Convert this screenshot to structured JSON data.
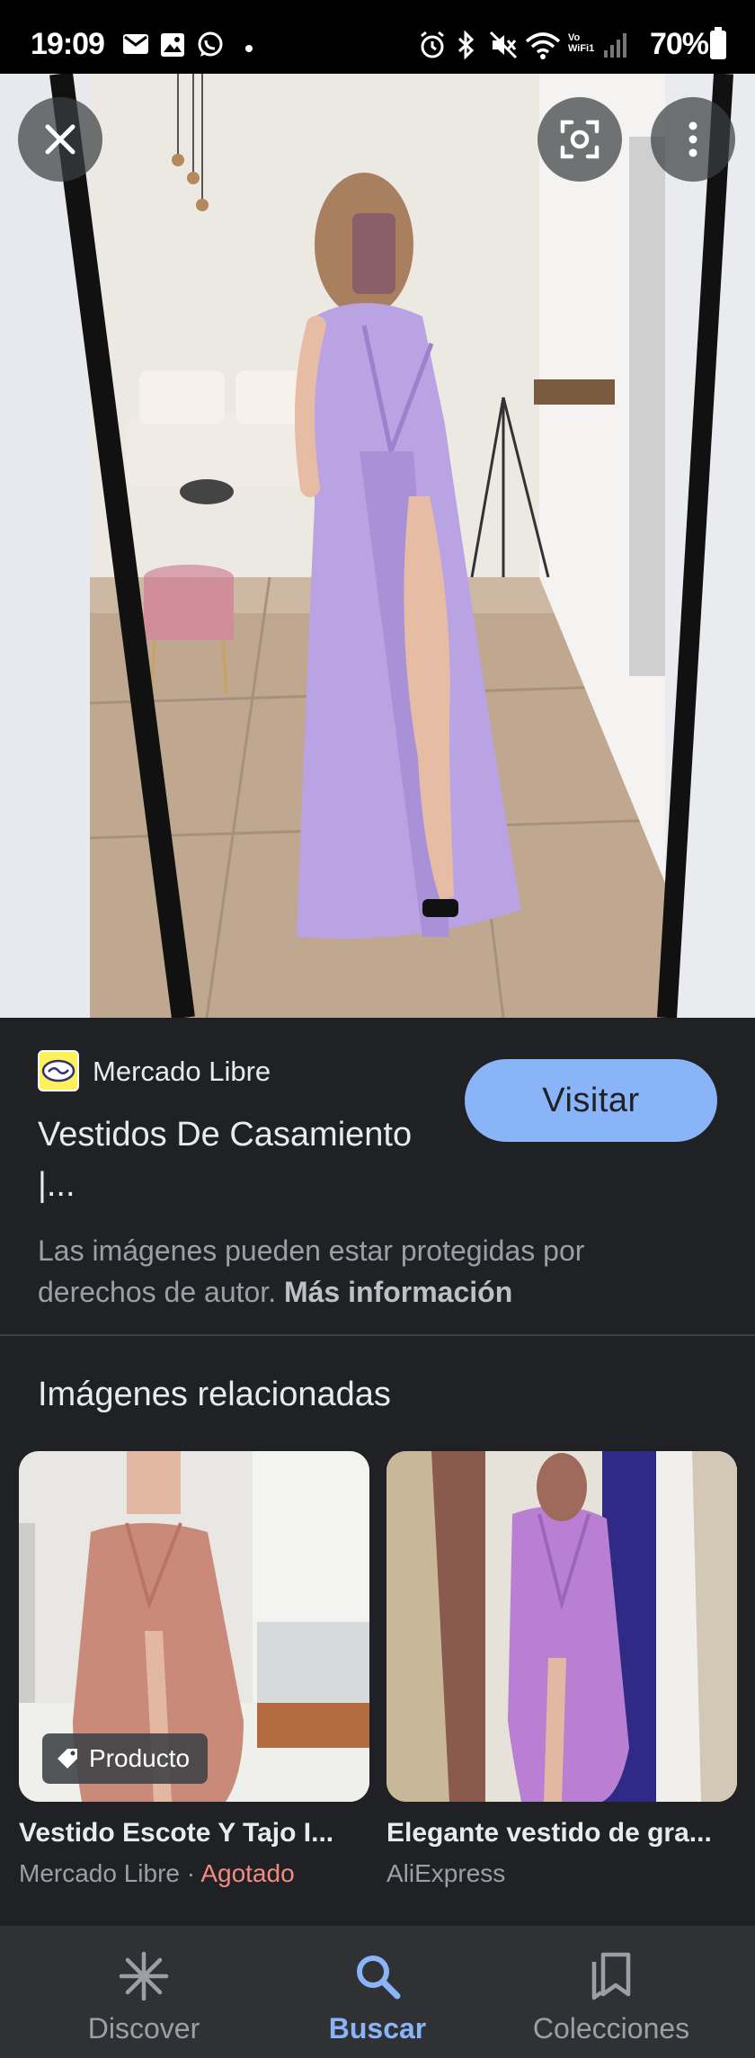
{
  "status_bar": {
    "time": "19:09",
    "battery": "70%",
    "vowifi": [
      "Vo",
      "WiFi1"
    ],
    "icons": [
      "gmail-icon",
      "gallery-icon",
      "whatsapp-icon",
      "dot-icon",
      "alarm-icon",
      "bluetooth-icon",
      "mute-icon",
      "wifi-icon",
      "vowifi-icon",
      "signal-icon",
      "battery-icon"
    ]
  },
  "image_viewer": {
    "close_icon": "close-icon",
    "lens_icon": "google-lens-icon",
    "more_icon": "more-vert-icon"
  },
  "result": {
    "source": "Mercado Libre",
    "title": "Vestidos De Casamiento |...",
    "visit_label": "Visitar",
    "copyright_text": "Las imágenes pueden estar protegidas por derechos de autor.",
    "more_info_link": "Más información"
  },
  "related": {
    "heading": "Imágenes relacionadas",
    "items": [
      {
        "title": "Vestido Escote Y Tajo I...",
        "source": "Mercado Libre",
        "separator": " · ",
        "status": "Agotado",
        "chip": "Producto"
      },
      {
        "title": "Elegante vestido de gra...",
        "source": "AliExpress"
      }
    ]
  },
  "bottom_nav": {
    "items": [
      {
        "label": "Discover",
        "icon": "discover-asterisk-icon",
        "active": false
      },
      {
        "label": "Buscar",
        "icon": "search-icon",
        "active": true
      },
      {
        "label": "Colecciones",
        "icon": "collections-bookmark-icon",
        "active": false
      }
    ]
  },
  "colors": {
    "background": "#202124",
    "accent": "#8ab4f8",
    "sold_out": "#f28b82",
    "secondary_text": "#9aa0a6",
    "dress_hero": "#b9a3e3",
    "dress_related_1": "#c98a7a"
  }
}
